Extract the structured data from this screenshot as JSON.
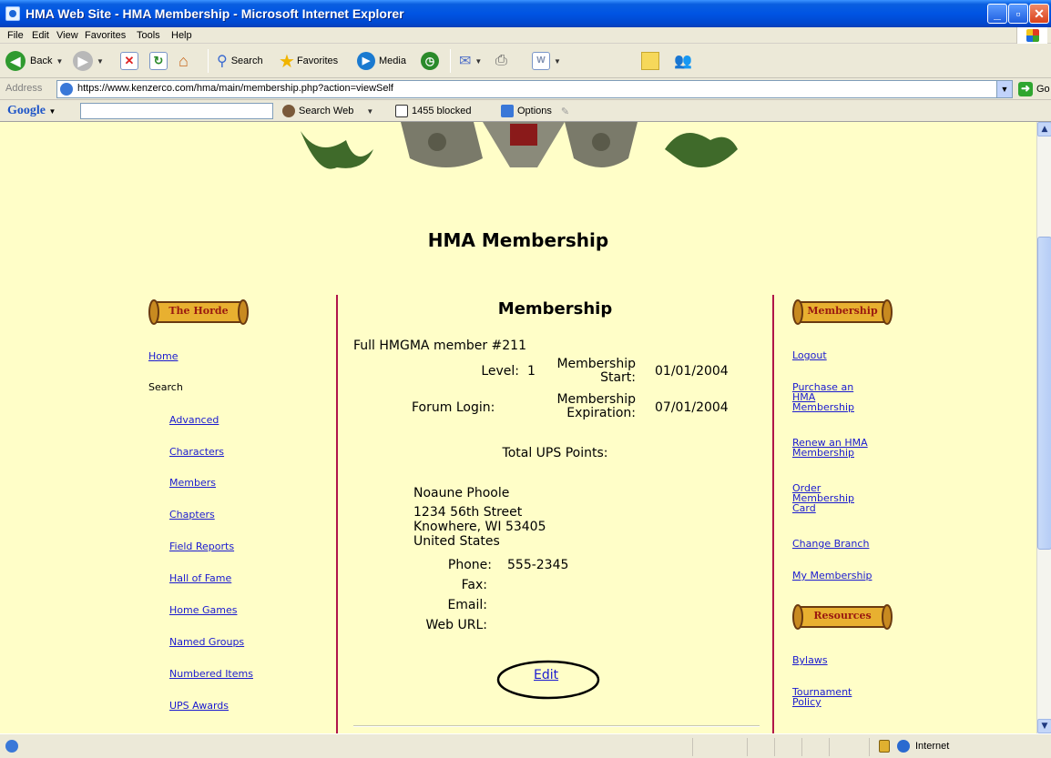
{
  "window": {
    "title": "HMA Web Site - HMA Membership - Microsoft Internet Explorer"
  },
  "menu": [
    "File",
    "Edit",
    "View",
    "Favorites",
    "Tools",
    "Help"
  ],
  "toolbar": {
    "back": "Back",
    "search": "Search",
    "favorites": "Favorites",
    "media": "Media"
  },
  "address": {
    "label": "Address",
    "url": "https://www.kenzerco.com/hma/main/membership.php?action=viewSelf",
    "go": "Go"
  },
  "google_bar": {
    "logo": "Google",
    "search_web": "Search Web",
    "blocked": "1455 blocked",
    "options": "Options"
  },
  "page": {
    "heading": "HMA Membership",
    "left_badge": "The Horde",
    "left_nav": {
      "home": "Home",
      "search": "Search",
      "items": [
        "Advanced",
        "Characters",
        "Members",
        "Chapters",
        "Field Reports",
        "Hall of Fame",
        "Home Games",
        "Named Groups",
        "Numbered Items",
        "UPS Awards"
      ]
    },
    "center": {
      "title": "Membership",
      "member_line": "Full HMGMA member #211",
      "level_label": "Level:",
      "level_value": "1",
      "start_label": "Membership Start:",
      "start_value": "01/01/2004",
      "forum_label": "Forum Login:",
      "expiration_label": "Membership Expiration:",
      "expiration_value": "07/01/2004",
      "ups_label": "Total UPS Points:",
      "name": "Noaune Phoole",
      "street": "1234 56th Street",
      "city": "Knowhere, WI 53405",
      "country": "United States",
      "phone_label": "Phone:",
      "phone_value": "555-2345",
      "fax_label": "Fax:",
      "email_label": "Email:",
      "web_label": "Web URL:",
      "edit": "Edit"
    },
    "right_badge_1": "Membership",
    "right_nav_1": {
      "logout": "Logout",
      "purchase": [
        "Purchase an",
        "HMA",
        "Membership"
      ],
      "renew": [
        "Renew an HMA",
        "Membership"
      ],
      "order": [
        "Order",
        "Membership",
        "Card"
      ],
      "change_branch": "Change Branch",
      "my_membership": "My Membership"
    },
    "right_badge_2": "Resources",
    "right_nav_2": {
      "bylaws": "Bylaws",
      "tournament": [
        "Tournament",
        "Policy"
      ]
    }
  },
  "status": {
    "zone": "Internet"
  }
}
